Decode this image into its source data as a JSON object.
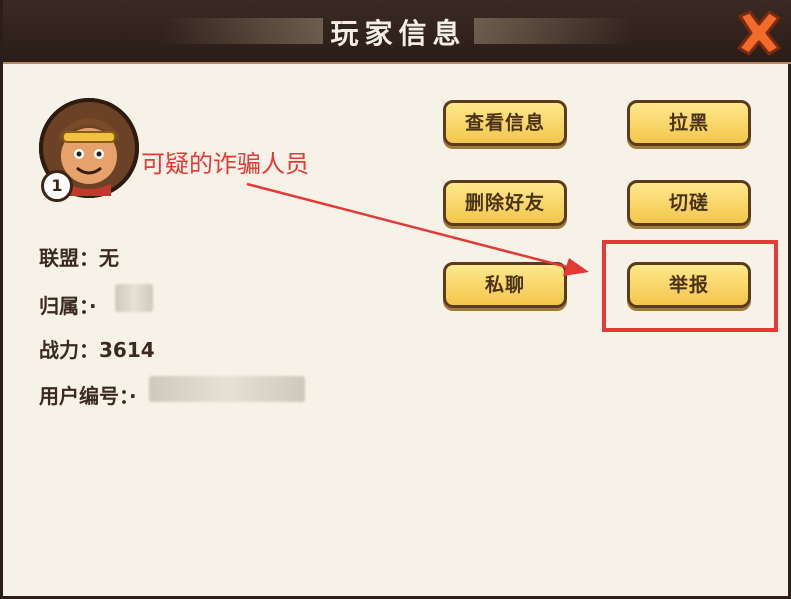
{
  "window": {
    "title": "玩家信息"
  },
  "profile": {
    "level": "1",
    "fields": [
      {
        "label": "联盟：",
        "value": "无"
      },
      {
        "label": "归属：",
        "value": "·"
      },
      {
        "label": "战力：",
        "value": "3614"
      },
      {
        "label": "用户编号：",
        "value": "·"
      }
    ]
  },
  "actions": {
    "view_info": "查看信息",
    "block": "拉黑",
    "delete_friend": "删除好友",
    "spar": "切磋",
    "private_chat": "私聊",
    "report": "举报"
  },
  "annotation": {
    "text": "可疑的诈骗人员"
  },
  "colors": {
    "accent_red": "#e53935",
    "button_fill": "#f3c64a",
    "panel_bg": "#f6f2e7",
    "titlebar": "#2a1c17"
  },
  "icons": [
    "close-icon",
    "avatar-portrait",
    "arrow-icon"
  ]
}
